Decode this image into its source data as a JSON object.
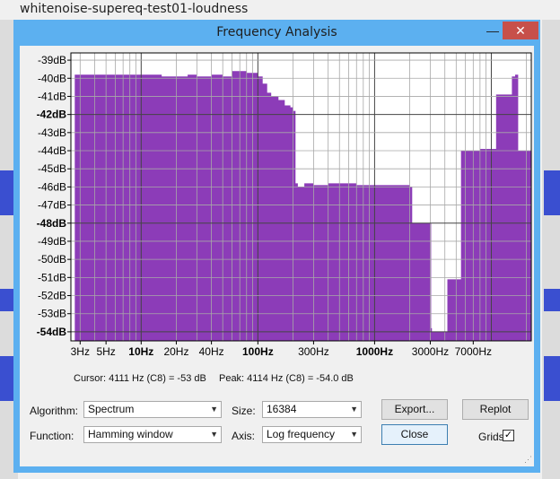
{
  "app": {
    "window_title": "whitenoise-supereq-test01-loudness"
  },
  "dialog": {
    "title": "Frequency Analysis",
    "minimize_glyph": "—",
    "close_glyph": "✕",
    "colors": {
      "titlebar": "#5cb0f0",
      "close": "#c7504a",
      "spectrum": "#8c3cb8"
    }
  },
  "status": {
    "cursor": "Cursor: 4111 Hz (C8) = -53 dB",
    "peak": "Peak: 4114 Hz (C8) = -54.0 dB"
  },
  "controls": {
    "algorithm_label": "Algorithm:",
    "algorithm_value": "Spectrum",
    "size_label": "Size:",
    "size_value": "16384",
    "function_label": "Function:",
    "function_value": "Hamming window",
    "axis_label": "Axis:",
    "axis_value": "Log frequency",
    "export_label": "Export...",
    "replot_label": "Replot",
    "close_label": "Close",
    "grids_label": "Grids",
    "grids_checked": true
  },
  "chart_data": {
    "type": "area",
    "title": "",
    "xlabel": "",
    "ylabel": "",
    "xscale": "log",
    "xlim": [
      2.5,
      22000
    ],
    "ylim": [
      -54.5,
      -38.6
    ],
    "grid": true,
    "y_ticks": [
      "-39dB",
      "-40dB",
      "-41dB",
      "-42dB",
      "-43dB",
      "-44dB",
      "-45dB",
      "-46dB",
      "-47dB",
      "-48dB",
      "-49dB",
      "-50dB",
      "-51dB",
      "-52dB",
      "-53dB",
      "-54dB"
    ],
    "y_tick_values": [
      -39,
      -40,
      -41,
      -42,
      -43,
      -44,
      -45,
      -46,
      -47,
      -48,
      -49,
      -50,
      -51,
      -52,
      -53,
      -54
    ],
    "y_bold": [
      -42,
      -48,
      -54
    ],
    "x_ticks": [
      "3Hz",
      "5Hz",
      "10Hz",
      "20Hz",
      "40Hz",
      "100Hz",
      "300Hz",
      "1000Hz",
      "3000Hz",
      "7000Hz"
    ],
    "x_tick_values": [
      3,
      5,
      10,
      20,
      40,
      100,
      300,
      1000,
      3000,
      7000
    ],
    "x_bold": [
      "10Hz",
      "100Hz",
      "1000Hz"
    ],
    "series": [
      {
        "x": [
          2.7,
          4,
          6,
          10,
          15,
          20,
          25,
          30,
          40,
          50,
          60,
          80,
          100,
          110,
          120,
          130,
          150,
          170,
          190,
          200,
          210,
          220,
          250,
          300,
          400,
          500,
          700,
          1000,
          1500,
          2000,
          2100,
          3000,
          3050,
          3100,
          4000,
          4200,
          4400,
          5200,
          5500,
          6000,
          7000,
          8000,
          10000,
          11000,
          13000,
          15000,
          16000,
          17000,
          22000
        ],
        "y": [
          -39.8,
          -39.8,
          -39.8,
          -39.8,
          -39.9,
          -39.9,
          -39.8,
          -39.9,
          -39.8,
          -39.9,
          -39.6,
          -39.7,
          -39.9,
          -40.3,
          -40.8,
          -41.0,
          -41.2,
          -41.5,
          -41.6,
          -41.8,
          -45.8,
          -46.0,
          -45.8,
          -45.9,
          -45.8,
          -45.8,
          -45.9,
          -45.9,
          -45.9,
          -46.0,
          -48.0,
          -48.0,
          -53.8,
          -54.0,
          -54.0,
          -51.1,
          -51.1,
          -51.1,
          -44.0,
          -44.0,
          -44.0,
          -43.9,
          -43.9,
          -40.9,
          -40.9,
          -39.9,
          -39.8,
          -44.0,
          -44.0
        ]
      }
    ]
  }
}
